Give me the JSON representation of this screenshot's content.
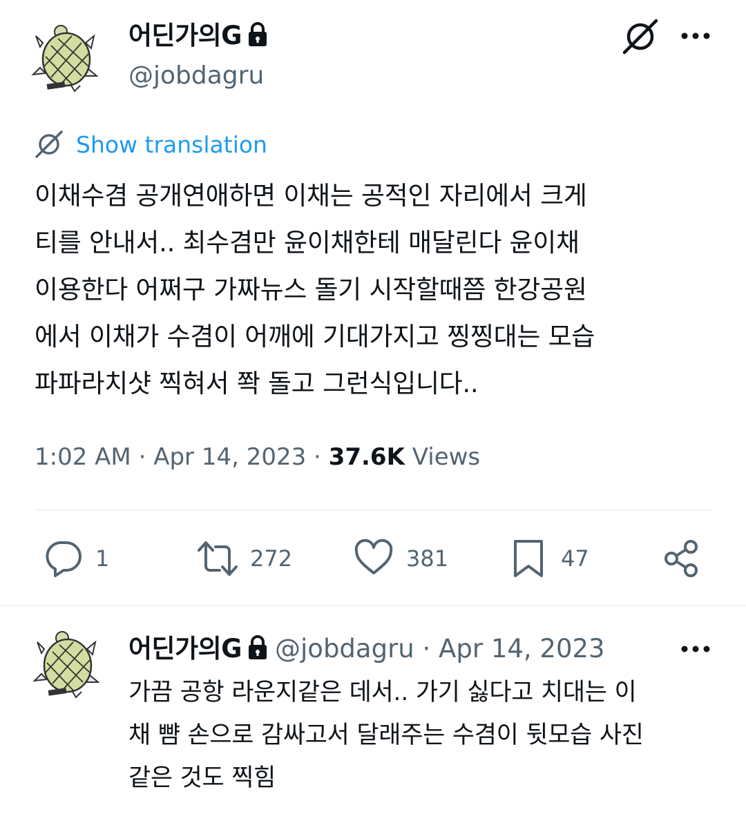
{
  "main_tweet": {
    "author": {
      "display_name": "어딘가의G",
      "handle": "@jobdagru",
      "avatar_icon": "turtle-avatar-icon",
      "protected_icon": "lock-icon"
    },
    "header_actions": {
      "grok_icon": "grok-icon",
      "more_icon": "more-options-icon"
    },
    "translation": {
      "icon": "translate-icon",
      "label": "Show translation"
    },
    "text_lines": [
      "이채수겸 공개연애하면 이채는 공적인 자리에서 크게",
      "티를 안내서.. 최수겸만 윤이채한테 매달린다 윤이채",
      "이용한다 어쩌구 가짜뉴스 돌기 시작할때쯤 한강공원",
      "에서 이채가 수겸이 어깨에 기대가지고 찡찡대는 모습",
      "파파라치샷 찍혀서 쫙 돌고 그런식입니다.."
    ],
    "meta": {
      "time": "1:02 AM",
      "sep1": " · ",
      "date": "Apr 14, 2023",
      "sep2": " · ",
      "views_count": "37.6K",
      "views_label": " Views"
    },
    "actions": {
      "replies": {
        "icon": "reply-icon",
        "count": "1"
      },
      "reposts": {
        "icon": "repost-icon",
        "count": "272"
      },
      "likes": {
        "icon": "heart-icon",
        "count": "381"
      },
      "bookmarks": {
        "icon": "bookmark-icon",
        "count": "47"
      },
      "share": {
        "icon": "share-icon"
      }
    }
  },
  "reply_tweet": {
    "author": {
      "display_name": "어딘가의G",
      "handle": "@jobdagru",
      "avatar_icon": "turtle-avatar-icon",
      "protected_icon": "lock-icon"
    },
    "separator": " · ",
    "date": "Apr 14, 2023",
    "more_icon": "more-options-icon",
    "text_lines": [
      "가끔 공항 라운지같은 데서.. 가기 싫다고 치대는 이",
      "채 뺨 손으로 감싸고서 달래주는 수겸이 뒷모습 사진",
      "같은 것도 찍힘"
    ]
  },
  "colors": {
    "text_primary": "#0f1419",
    "text_secondary": "#536471",
    "link": "#1d9bf0",
    "divider": "#eff3f4"
  }
}
